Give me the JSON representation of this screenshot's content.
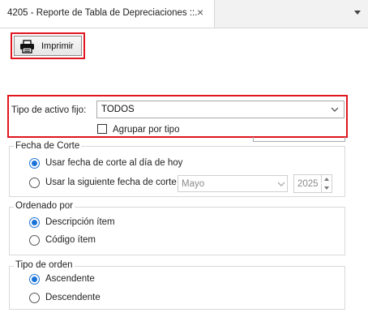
{
  "tab": {
    "title": "4205 - Reporte de Tabla de Depreciaciones ::.",
    "close_glyph": "×",
    "menu_icon": "dropdown-arrow-icon"
  },
  "toolbar": {
    "print_label": "Imprimir",
    "print_icon": "printer-icon"
  },
  "asset_filter": {
    "label": "Tipo de activo fijo:",
    "selected": "TODOS",
    "group_label": "Agrupar por tipo",
    "group_checked": false
  },
  "cutoff": {
    "legend": "Fecha de Corte",
    "options": [
      {
        "label": "Usar fecha de corte al día de hoy",
        "selected": true
      },
      {
        "label": "Usar la siguiente fecha de corte",
        "selected": false
      }
    ],
    "month": "Mayo",
    "year": "2025"
  },
  "order_by": {
    "legend": "Ordenado por",
    "options": [
      {
        "label": "Descripción ítem",
        "selected": true
      },
      {
        "label": "Código ítem",
        "selected": false
      }
    ]
  },
  "sort_type": {
    "legend": "Tipo de orden",
    "options": [
      {
        "label": "Ascendente",
        "selected": true
      },
      {
        "label": "Descendente",
        "selected": false
      }
    ]
  },
  "colors": {
    "highlight": "#e0151f",
    "accent": "#1a73d9"
  }
}
